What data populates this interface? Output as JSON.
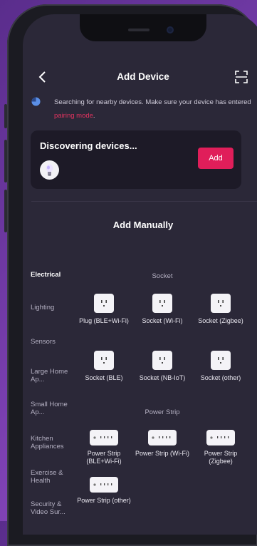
{
  "header": {
    "title": "Add Device"
  },
  "search": {
    "message": "Searching for nearby devices. Make sure your device has entered",
    "link": "pairing mode",
    "suffix": "."
  },
  "discovery": {
    "label": "Discovering devices...",
    "add_label": "Add"
  },
  "add_manually": "Add Manually",
  "categories": [
    "Electrical",
    "Lighting",
    "Sensors",
    "Large Home Ap...",
    "Small Home Ap...",
    "Kitchen Appliances",
    "Exercise & Health",
    "Security & Video Sur..."
  ],
  "sections": {
    "socket": {
      "title": "Socket",
      "items": [
        "Plug (BLE+Wi-Fi)",
        "Socket (Wi-Fi)",
        "Socket (Zigbee)",
        "Socket (BLE)",
        "Socket (NB-IoT)",
        "Socket (other)"
      ]
    },
    "power_strip": {
      "title": "Power Strip",
      "items": [
        "Power Strip (BLE+Wi-Fi)",
        "Power Strip (Wi-Fi)",
        "Power Strip (Zigbee)",
        "Power Strip (other)"
      ]
    }
  },
  "colors": {
    "accent": "#e01e5a",
    "background": "#2b2838",
    "card": "#1d1a27"
  }
}
